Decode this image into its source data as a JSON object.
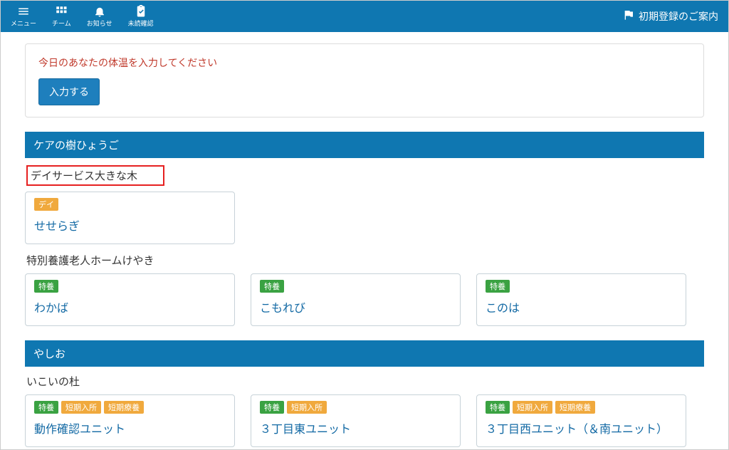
{
  "topbar": {
    "nav": [
      {
        "label": "メニュー"
      },
      {
        "label": "チーム"
      },
      {
        "label": "お知らせ"
      },
      {
        "label": "未読確認"
      }
    ],
    "rightLink": "初期登録のご案内"
  },
  "notice": {
    "text": "今日のあなたの体温を入力してください",
    "button": "入力する"
  },
  "tags": {
    "day": "デイ",
    "tokuyo": "特養",
    "tankiNyusho": "短期入所",
    "tankiRyoyo": "短期療養"
  },
  "sections": [
    {
      "header": "ケアの樹ひょうご",
      "groups": [
        {
          "subheader": "デイサービス大きな木",
          "highlighted": true,
          "cards": [
            {
              "badges": [
                "day"
              ],
              "title": "せせらぎ"
            }
          ]
        },
        {
          "subheader": "特別養護老人ホームけやき",
          "highlighted": false,
          "cards": [
            {
              "badges": [
                "tokuyo"
              ],
              "title": "わかば"
            },
            {
              "badges": [
                "tokuyo"
              ],
              "title": "こもれび"
            },
            {
              "badges": [
                "tokuyo"
              ],
              "title": "このは"
            }
          ]
        }
      ]
    },
    {
      "header": "やしお",
      "groups": [
        {
          "subheader": "いこいの杜",
          "highlighted": false,
          "cards": [
            {
              "badges": [
                "tokuyo",
                "tankiNyusho",
                "tankiRyoyo"
              ],
              "title": "動作確認ユニット"
            },
            {
              "badges": [
                "tokuyo",
                "tankiNyusho"
              ],
              "title": "３丁目東ユニット"
            },
            {
              "badges": [
                "tokuyo",
                "tankiNyusho",
                "tankiRyoyo"
              ],
              "title": "３丁目西ユニット（＆南ユニット）"
            }
          ]
        }
      ]
    }
  ]
}
